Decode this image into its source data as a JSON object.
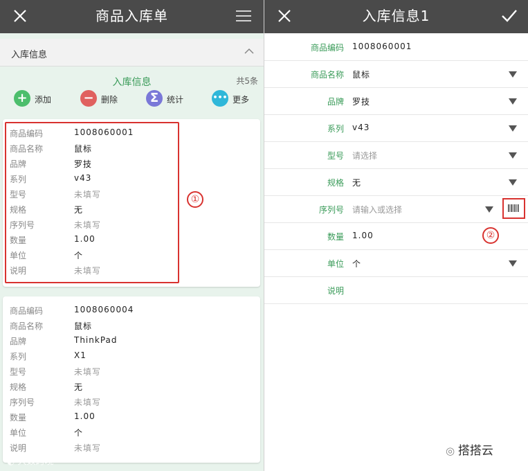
{
  "left": {
    "title": "商品入库单",
    "section_label": "入库信息",
    "inner_title": "入库信息",
    "count": "共5条",
    "actions": [
      {
        "label": "添加",
        "symbol": "+",
        "color": "#4cbe6c"
      },
      {
        "label": "删除",
        "symbol": "−",
        "color": "#e0615f"
      },
      {
        "label": "统计",
        "symbol": "Σ",
        "color": "#7a78d8"
      },
      {
        "label": "更多",
        "symbol": "•••",
        "color": "#2fb7d9"
      }
    ],
    "cards": [
      {
        "rows": [
          {
            "key": "商品编码",
            "value": "1008060001"
          },
          {
            "key": "商品名称",
            "value": "鼠标"
          },
          {
            "key": "品牌",
            "value": "罗技"
          },
          {
            "key": "系列",
            "value": "v43"
          },
          {
            "key": "型号",
            "value": "未填写"
          },
          {
            "key": "规格",
            "value": "无"
          },
          {
            "key": "序列号",
            "value": "未填写"
          },
          {
            "key": "数量",
            "value": "1.00"
          },
          {
            "key": "单位",
            "value": "个"
          },
          {
            "key": "说明",
            "value": "未填写"
          }
        ]
      },
      {
        "rows": [
          {
            "key": "商品编码",
            "value": "1008060004"
          },
          {
            "key": "商品名称",
            "value": "鼠标"
          },
          {
            "key": "品牌",
            "value": "ThinkPad"
          },
          {
            "key": "系列",
            "value": "X1"
          },
          {
            "key": "型号",
            "value": "未填写"
          },
          {
            "key": "规格",
            "value": "无"
          },
          {
            "key": "序列号",
            "value": "未填写"
          },
          {
            "key": "数量",
            "value": "1.00"
          },
          {
            "key": "单位",
            "value": "个"
          },
          {
            "key": "说明",
            "value": "未填写"
          }
        ]
      }
    ],
    "marker": "①",
    "watermark": "大数跨境"
  },
  "right": {
    "title": "入库信息1",
    "fields": [
      {
        "label": "商品编码",
        "value": "1008060001",
        "placeholder": false,
        "dropdown": false
      },
      {
        "label": "商品名称",
        "value": "鼠标",
        "placeholder": false,
        "dropdown": true
      },
      {
        "label": "品牌",
        "value": "罗技",
        "placeholder": false,
        "dropdown": true
      },
      {
        "label": "系列",
        "value": "v43",
        "placeholder": false,
        "dropdown": true
      },
      {
        "label": "型号",
        "value": "请选择",
        "placeholder": true,
        "dropdown": true
      },
      {
        "label": "规格",
        "value": "无",
        "placeholder": false,
        "dropdown": true
      },
      {
        "label": "序列号",
        "value": "请输入或选择",
        "placeholder": true,
        "dropdown": true,
        "scan": true
      },
      {
        "label": "数量",
        "value": "1.00",
        "placeholder": false,
        "dropdown": false
      },
      {
        "label": "单位",
        "value": "个",
        "placeholder": false,
        "dropdown": true
      },
      {
        "label": "说明",
        "value": "",
        "placeholder": false,
        "dropdown": false
      }
    ],
    "marker": "②",
    "brand": "搭搭云"
  },
  "colors": {
    "topbar": "#4a4a4a",
    "accent_green": "#3a9b59",
    "annotation_red": "#d8322f"
  },
  "icons": {
    "left_close": "close-icon",
    "left_menu": "menu-icon",
    "right_close": "close-icon",
    "right_confirm": "check-icon",
    "collapse": "chevron-up-icon",
    "scan": "barcode-icon"
  }
}
